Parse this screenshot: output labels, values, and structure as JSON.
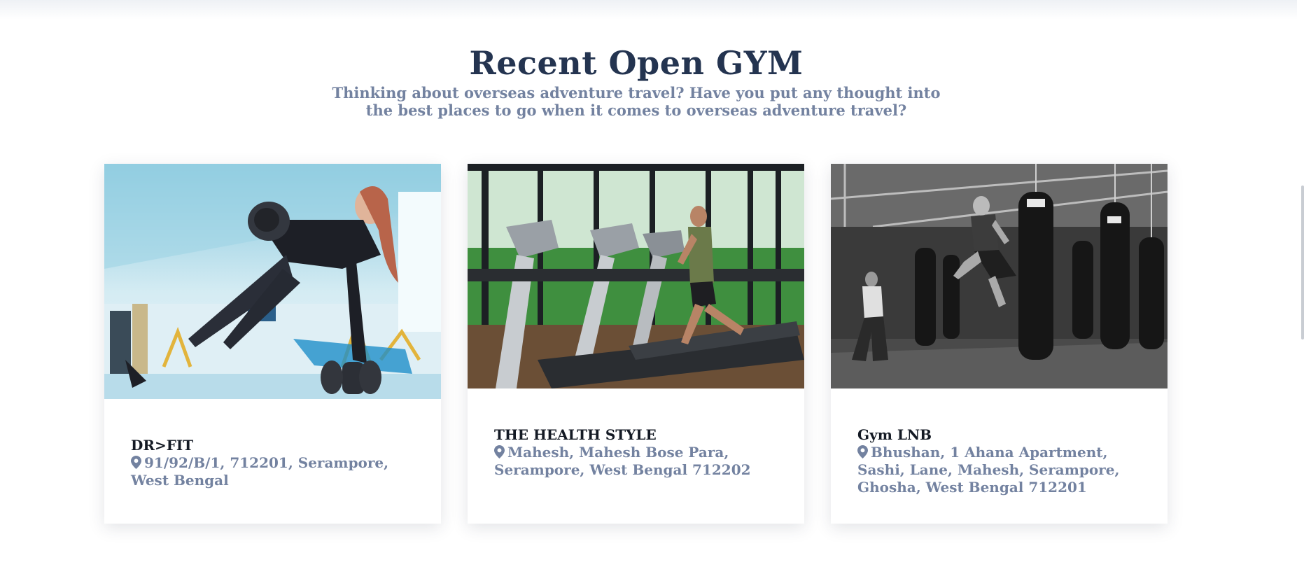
{
  "section": {
    "title": "Recent Open GYM",
    "subtitle": "Thinking about overseas adventure travel? Have you put any thought into the best places to go when it comes to overseas adventure travel?"
  },
  "gyms": [
    {
      "name": "DR>FIT",
      "address": "91/92/B/1, 712201, Serampore, West Bengal",
      "photo_icon": "woman-dumbbell-workout-photo"
    },
    {
      "name": "THE HEALTH STYLE",
      "address": "Mahesh, Mahesh Bose Para, Serampore, West Bengal 712202",
      "photo_icon": "treadmill-runner-photo"
    },
    {
      "name": "Gym LNB",
      "address": "Bhushan, 1 Ahana Apartment, Sashi, Lane, Mahesh, Serampore, Ghosha, West Bengal 712201",
      "photo_icon": "boxing-punching-bag-photo"
    }
  ],
  "colors": {
    "title": "#243450",
    "subtitle": "#7382a0",
    "name": "#141a24",
    "address": "#7382a0"
  },
  "icons": {
    "address": "map-pin-icon"
  }
}
